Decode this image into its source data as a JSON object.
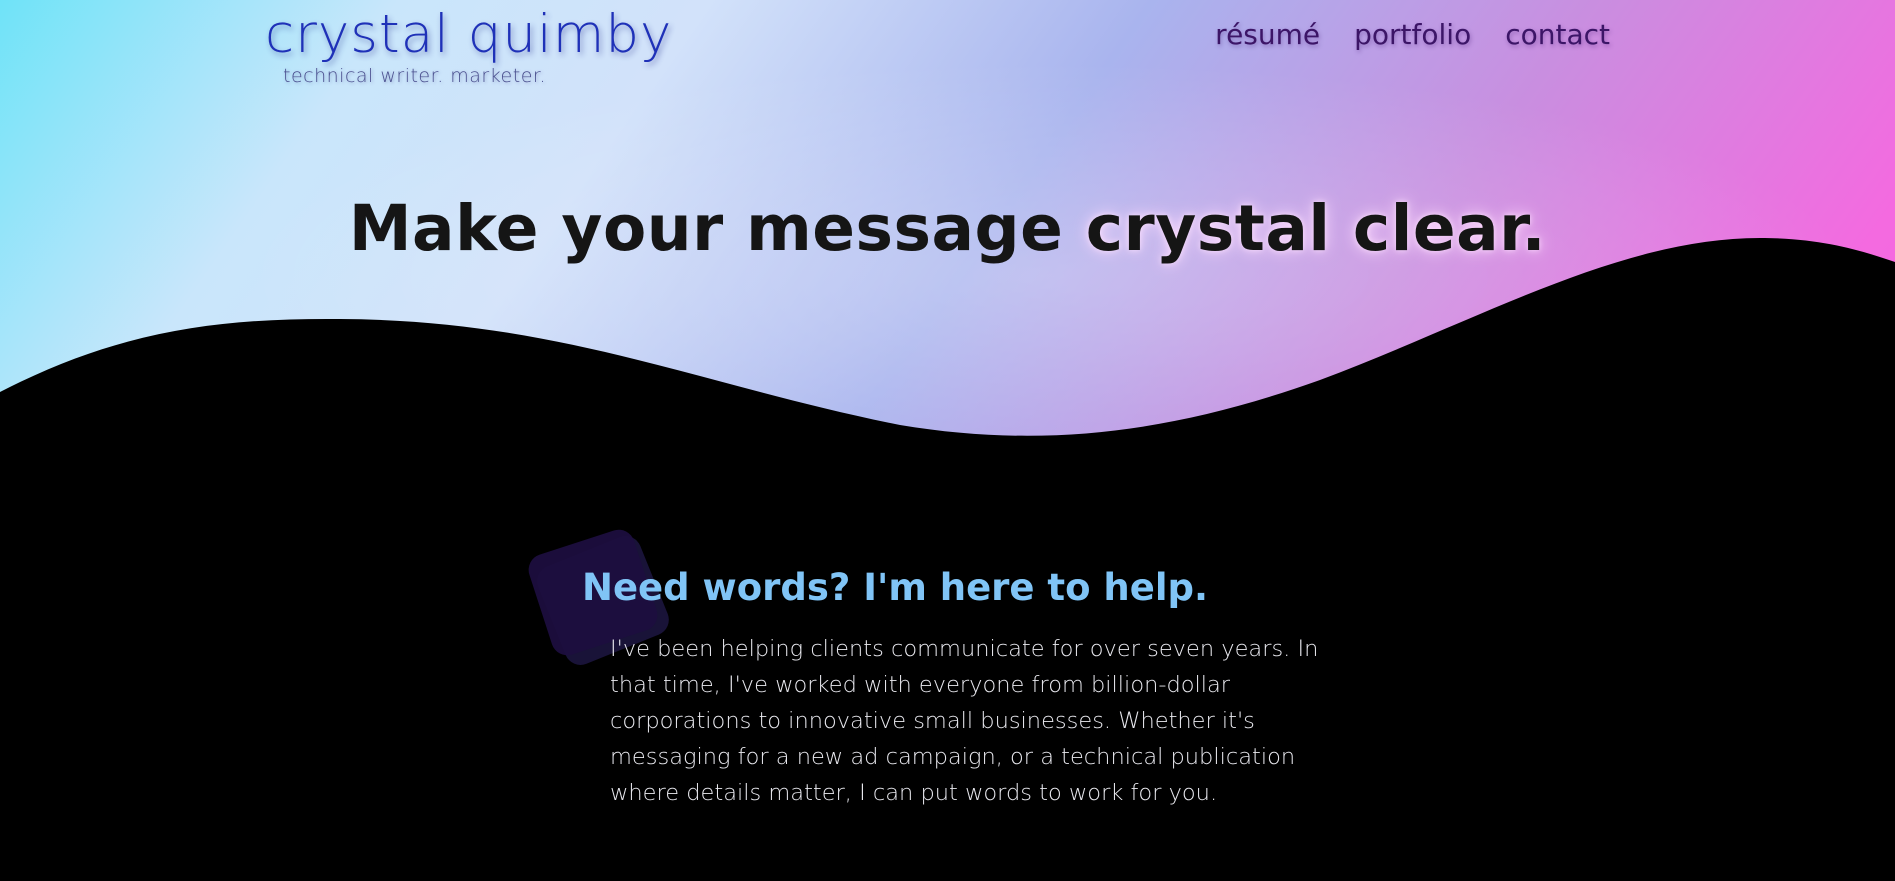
{
  "site": {
    "name": "crystal quimby",
    "tagline": "technical writer. marketer."
  },
  "nav": {
    "items": [
      {
        "label": "résumé"
      },
      {
        "label": "portfolio"
      },
      {
        "label": "contact"
      }
    ]
  },
  "hero": {
    "headline_part1": "Make your message ",
    "headline_part2": "crystal clear."
  },
  "intro": {
    "title": "Need words? I'm here to help.",
    "body": "I've been helping clients communicate for over seven years. In that time, I've worked with everyone from billion-dollar corporations to innovative small businesses. Whether it's messaging for a new ad campaign, or a technical publication where details matter, I can put words to work for you."
  },
  "colors": {
    "logo": "#1f31b8",
    "nav": "#3c1567",
    "section_title": "#80c4f6",
    "body_text": "#e8e8ee",
    "background_dark": "#000000",
    "gradient_start": "#6fe3f8",
    "gradient_end": "#f864df"
  }
}
